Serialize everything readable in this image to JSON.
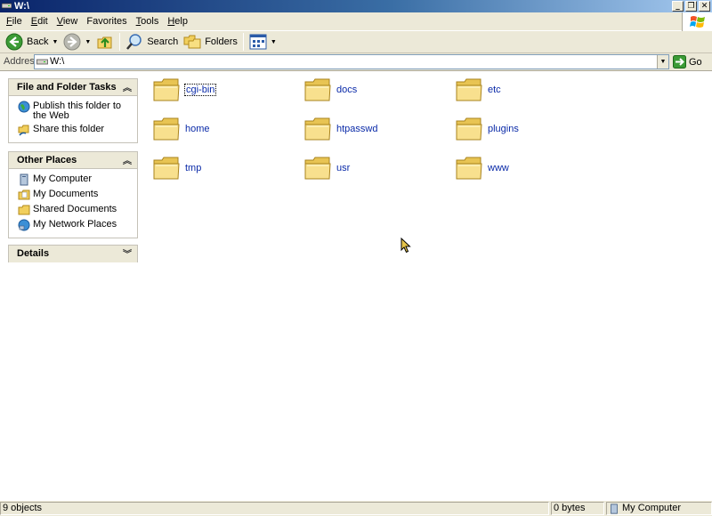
{
  "window": {
    "title": "W:\\"
  },
  "menu": {
    "items": [
      {
        "key": "F",
        "rest": "ile"
      },
      {
        "key": "E",
        "rest": "dit"
      },
      {
        "key": "V",
        "rest": "iew"
      },
      {
        "key": "F",
        "rest": "avorites",
        "prefix": ""
      },
      {
        "key": "T",
        "rest": "ools"
      },
      {
        "key": "H",
        "rest": "elp"
      }
    ]
  },
  "toolbar": {
    "back_label": "Back",
    "search_label": "Search",
    "folders_label": "Folders"
  },
  "address": {
    "label": "Address",
    "value": "W:\\",
    "go_label": "Go"
  },
  "tasks": {
    "file_folder": {
      "title": "File and Folder Tasks",
      "items": [
        "Publish this folder to the Web",
        "Share this folder"
      ]
    },
    "other_places": {
      "title": "Other Places",
      "items": [
        "My Computer",
        "My Documents",
        "Shared Documents",
        "My Network Places"
      ]
    },
    "details": {
      "title": "Details"
    }
  },
  "files": [
    "cgi-bin",
    "docs",
    "etc",
    "home",
    "htpasswd",
    "plugins",
    "tmp",
    "usr",
    "www"
  ],
  "status": {
    "objects": "9 objects",
    "size": "0 bytes",
    "location": "My Computer"
  },
  "colors": {
    "title_start": "#0a246a",
    "title_end": "#a6caf0",
    "link": "#0a2aa8",
    "chrome": "#ece9d8"
  },
  "icons": {
    "folder": "folder-icon",
    "back": "back-arrow-icon",
    "forward": "forward-arrow-icon",
    "up": "up-folder-icon",
    "search": "search-icon",
    "folders": "folders-icon",
    "views": "views-icon"
  }
}
